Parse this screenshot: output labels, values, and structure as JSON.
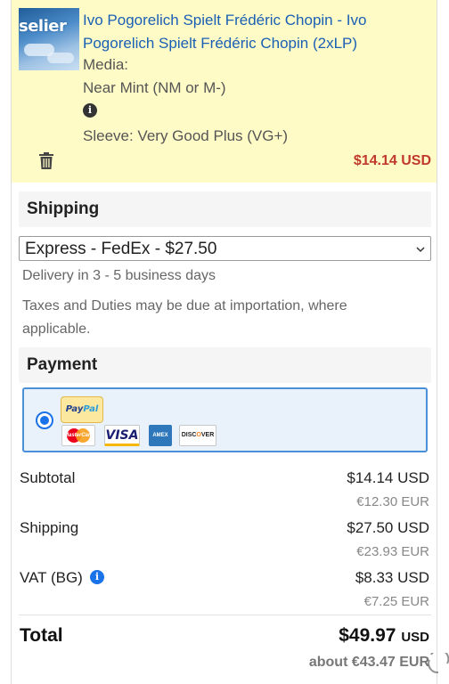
{
  "item": {
    "thumb_sticker": "selier",
    "title": "Ivo Pogorelich Spielt Frédéric Chopin - Ivo Pogorelich Spielt Frédéric Chopin (2xLP)",
    "media_label": "Media:",
    "media_value": "Near Mint (NM or M-)",
    "sleeve": "Sleeve: Very Good Plus (VG+)",
    "price": "$14.14 USD",
    "icons": [
      "info-icon",
      "trash-icon"
    ]
  },
  "shipping": {
    "heading": "Shipping",
    "selected_option": "Express - FedEx - $27.50",
    "delivery_note": "Delivery in 3 - 5 business days",
    "taxes_note": "Taxes and Duties may be due at importation, where applicable."
  },
  "payment": {
    "heading": "Payment",
    "selected": true,
    "paypal_logo": "PayPal",
    "cards": [
      "MasterCard",
      "VISA",
      "AMEX",
      "DISCOVER"
    ]
  },
  "summary": {
    "subtotal_label": "Subtotal",
    "subtotal_usd": "$14.14 USD",
    "subtotal_eur": "€12.30 EUR",
    "shipping_label": "Shipping",
    "shipping_usd": "$27.50 USD",
    "shipping_eur": "€23.93 EUR",
    "vat_label": "VAT (BG)",
    "vat_usd": "$8.33 USD",
    "vat_eur": "€7.25 EUR",
    "total_label": "Total",
    "total_usd": "$49.97",
    "total_currency": "USD",
    "total_eur": "about €43.47 EUR"
  },
  "colors": {
    "item_background": "#fffbc7",
    "link": "#1a5fb4",
    "price": "#c0392b",
    "accent": "#1a73e8"
  }
}
